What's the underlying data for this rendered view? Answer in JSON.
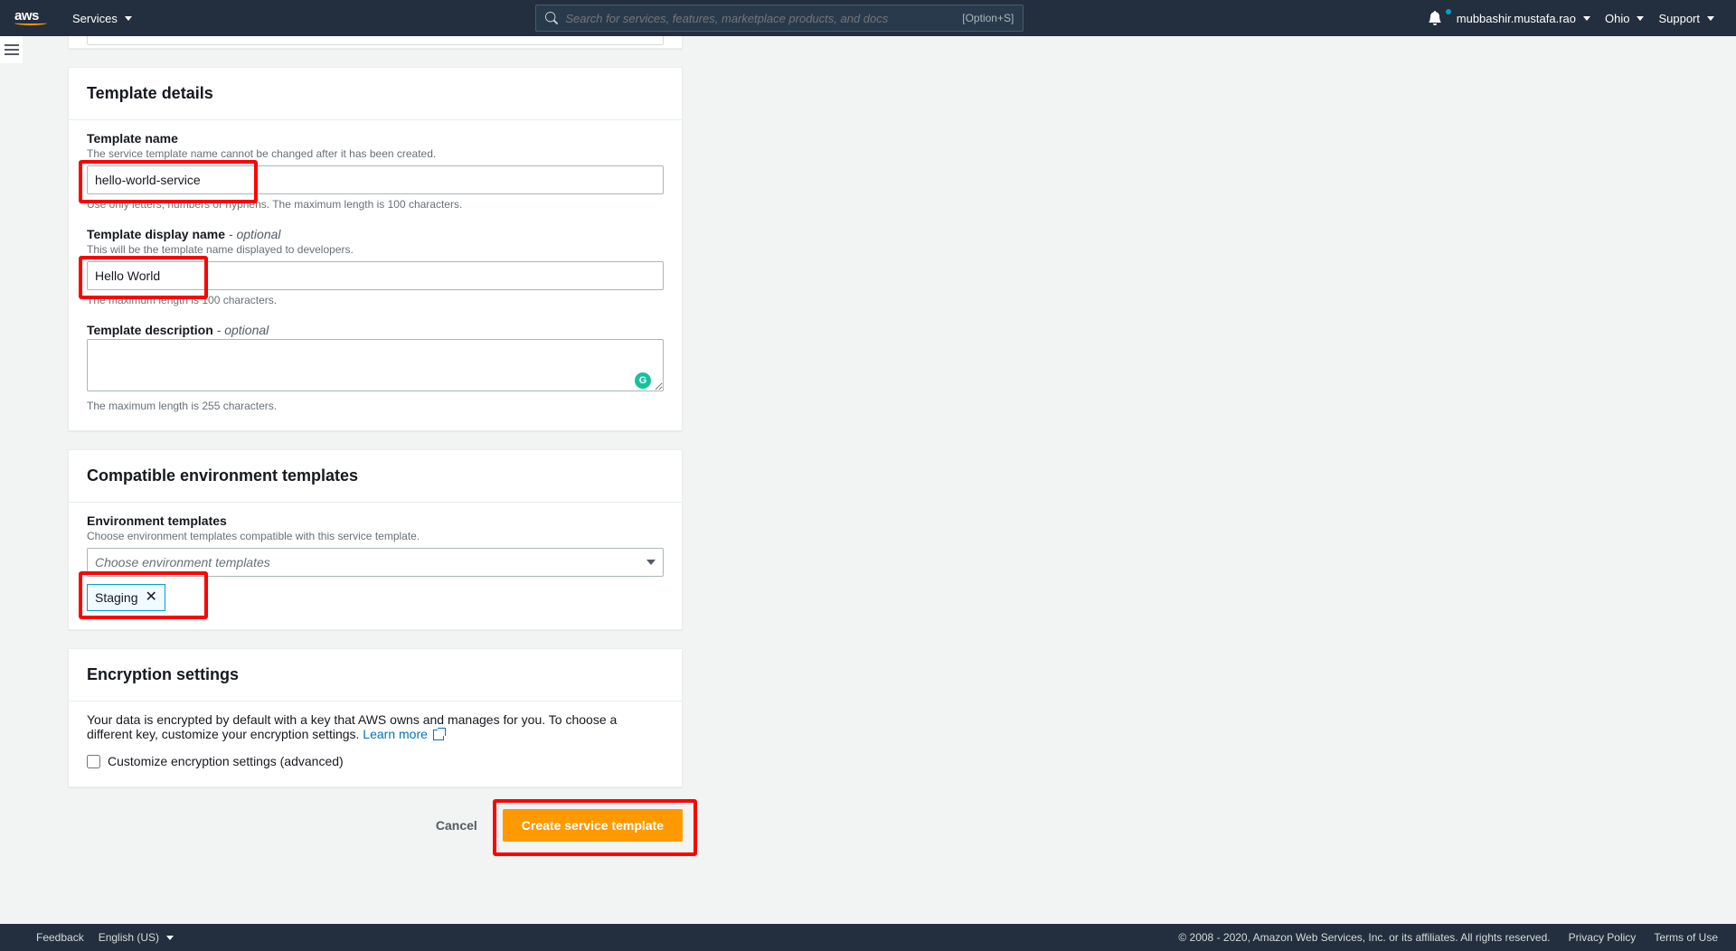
{
  "topnav": {
    "services": "Services",
    "search_placeholder": "Search for services, features, marketplace products, and docs",
    "search_shortcut": "[Option+S]",
    "username": "mubbashir.mustafa.rao",
    "region": "Ohio",
    "support": "Support"
  },
  "template_details": {
    "title": "Template details",
    "name_label": "Template name",
    "name_hint": "The service template name cannot be changed after it has been created.",
    "name_value": "hello-world-service",
    "name_help": "Use only letters, numbers or hyphens. The maximum length is 100 characters.",
    "display_label": "Template display name",
    "display_optional": " - optional",
    "display_hint": "This will be the template name displayed to developers.",
    "display_value": "Hello World",
    "display_help": "The maximum length is 100 characters.",
    "desc_label": "Template description",
    "desc_optional": " - optional",
    "desc_help": "The maximum length is 255 characters."
  },
  "compat": {
    "title": "Compatible environment templates",
    "label": "Environment templates",
    "hint": "Choose environment templates compatible with this service template.",
    "placeholder": "Choose environment templates",
    "chip": "Staging"
  },
  "encryption": {
    "title": "Encryption settings",
    "body_prefix": "Your data is encrypted by default with a key that AWS owns and manages for you. To choose a different key, customize your encryption settings. ",
    "learn_more": "Learn more",
    "checkbox": "Customize encryption settings (advanced)"
  },
  "actions": {
    "cancel": "Cancel",
    "create": "Create service template"
  },
  "footer": {
    "feedback": "Feedback",
    "language": "English (US)",
    "copyright": "© 2008 - 2020, Amazon Web Services, Inc. or its affiliates. All rights reserved.",
    "privacy": "Privacy Policy",
    "terms": "Terms of Use"
  }
}
